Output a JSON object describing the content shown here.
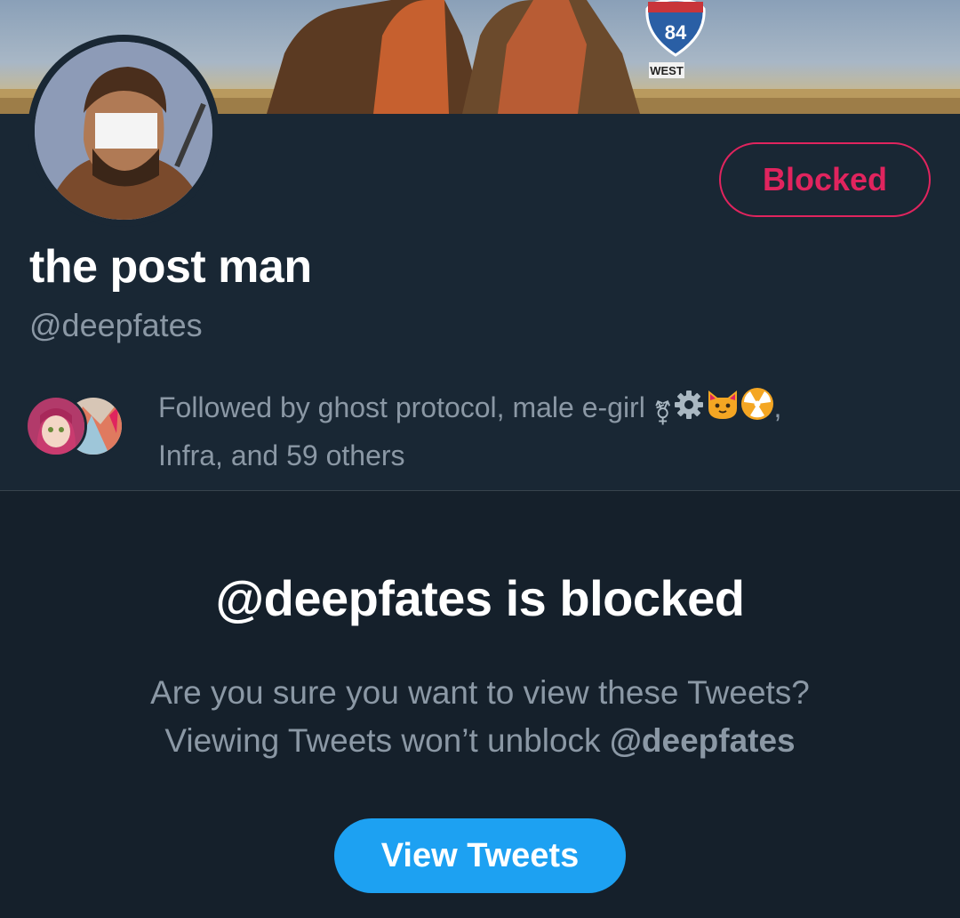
{
  "profile": {
    "display_name": "the post man",
    "handle": "@deepfates",
    "blocked_button_label": "Blocked",
    "followed_by_prefix": "Followed by ghost protocol, male e-girl ",
    "followed_by_emoji": [
      "⚧",
      "⚙",
      "🐱",
      "☢"
    ],
    "followed_by_comma": ",",
    "followed_by_suffix": "Infra, and 59 others"
  },
  "banner": {
    "sign_text": "WEST",
    "sign_number": "84"
  },
  "blocked_notice": {
    "title": "@deepfates is blocked",
    "line1": "Are you sure you want to view these Tweets?",
    "line2_prefix": "Viewing Tweets won’t unblock ",
    "line2_handle": "@deepfates",
    "view_button_label": "View Tweets"
  },
  "colors": {
    "background": "#15202b",
    "profile_background": "#192734",
    "blocked_red": "#e0245e",
    "accent_blue": "#1da1f2",
    "secondary_text": "#8b98a5"
  }
}
